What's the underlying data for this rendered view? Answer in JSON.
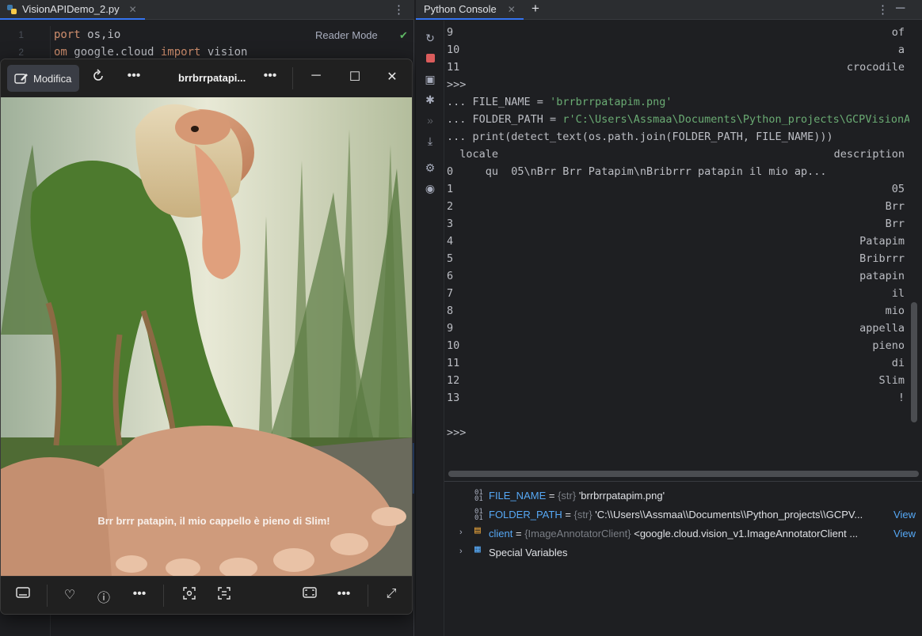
{
  "editor": {
    "tab_label": "VisionAPIDemo_2.py",
    "reader_mode": "Reader Mode",
    "lines": [
      {
        "num": "1",
        "kw": "",
        "kw_tail": "port",
        "rest": " os,io"
      },
      {
        "num": "2",
        "kw": "om",
        "rest": " google.cloud ",
        "kw2": "import",
        "rest2": " vision"
      }
    ]
  },
  "viewer": {
    "edit_label": "Modifica",
    "filename": "brrbrrpatapi...",
    "image_caption": "Brr brrr patapin, il mio cappello è pieno di Slim!",
    "icons": {
      "edit": "edit-icon",
      "rotate": "rotate-icon",
      "more": "more-icon",
      "minimize": "minimize-icon",
      "maximize": "maximize-icon",
      "close": "close-icon",
      "filmstrip": "filmstrip-icon",
      "favorite": "heart-icon",
      "info": "info-icon",
      "visual_search": "visual-search-icon",
      "text_detect": "text-detect-icon",
      "fit": "fit-screen-icon",
      "fullscreen": "fullscreen-icon"
    }
  },
  "console": {
    "tab_label": "Python Console",
    "output_top": [
      {
        "idx": "9",
        "val": "of"
      },
      {
        "idx": "10",
        "val": "a"
      },
      {
        "idx": "11",
        "val": "crocodile"
      }
    ],
    "prompt": ">>>",
    "cont": "...",
    "cmd1_pre": " FILE_NAME = ",
    "cmd1_str": "'brrbrrpatapim.png'",
    "cmd2_pre": " FOLDER_PATH = ",
    "cmd2_str": "r'C:\\Users\\Assmaa\\Documents\\Python_projects\\GCPVisionApiD",
    "cmd3": " print(detect_text(os.path.join(FOLDER_PATH, FILE_NAME)))",
    "header_left": "  locale",
    "header_right": "description",
    "row0": "0     qu  05\\nBrr Brr Patapim\\nBribrrr patapin il mio ap...",
    "rows": [
      {
        "idx": "1",
        "val": "05"
      },
      {
        "idx": "2",
        "val": "Brr"
      },
      {
        "idx": "3",
        "val": "Brr"
      },
      {
        "idx": "4",
        "val": "Patapim"
      },
      {
        "idx": "5",
        "val": "Bribrrr"
      },
      {
        "idx": "6",
        "val": "patapin"
      },
      {
        "idx": "7",
        "val": "il"
      },
      {
        "idx": "8",
        "val": "mio"
      },
      {
        "idx": "9",
        "val": "appella"
      },
      {
        "idx": "10",
        "val": "pieno"
      },
      {
        "idx": "11",
        "val": "di"
      },
      {
        "idx": "12",
        "val": "Slim"
      },
      {
        "idx": "13",
        "val": "!"
      }
    ],
    "final_prompt": ">>>"
  },
  "variables": [
    {
      "name": "FILE_NAME",
      "eq": " = ",
      "type": "{str}",
      "value": " 'brrbrrpatapim.png'",
      "expandable": false,
      "view": ""
    },
    {
      "name": "FOLDER_PATH",
      "eq": " = ",
      "type": "{str}",
      "value": " 'C:\\\\Users\\\\Assmaa\\\\Documents\\\\Python_projects\\\\GCPV...",
      "expandable": false,
      "view": "View"
    },
    {
      "name": "client",
      "eq": " = ",
      "type": "{ImageAnnotatorClient}",
      "value": " <google.cloud.vision_v1.ImageAnnotatorClient ...",
      "expandable": true,
      "view": "View"
    },
    {
      "name": "Special Variables",
      "eq": "",
      "type": "",
      "value": "",
      "expandable": true,
      "view": ""
    }
  ],
  "colors": {
    "accent": "#3574f0",
    "string": "#6aab73",
    "keyword": "#cf8e6d",
    "var_name": "#56a8f5"
  }
}
